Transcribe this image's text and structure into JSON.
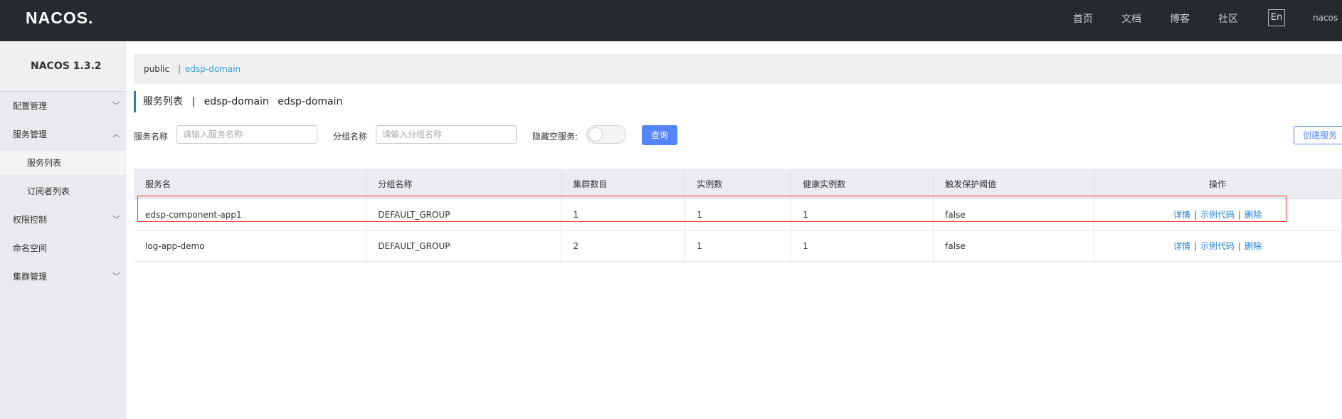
{
  "navbar": {
    "logo": "NACOS.",
    "links": [
      "首页",
      "文档",
      "博客",
      "社区"
    ],
    "lang": "En",
    "user": "nacos"
  },
  "sidebar": {
    "version": "NACOS 1.3.2",
    "items": [
      {
        "label": "配置管理",
        "expanded": false
      },
      {
        "label": "服务管理",
        "expanded": true
      },
      {
        "label": "服务列表",
        "sub": true,
        "active": true
      },
      {
        "label": "订阅者列表",
        "sub": true
      },
      {
        "label": "权限控制",
        "expanded": false
      },
      {
        "label": "命名空间"
      },
      {
        "label": "集群管理",
        "expanded": false
      }
    ]
  },
  "namespace": {
    "public": "public",
    "separator": "|",
    "current": "edsp-domain"
  },
  "title": {
    "main": "服务列表",
    "sep": "|",
    "ns1": "edsp-domain",
    "ns2": "edsp-domain"
  },
  "filters": {
    "service_label": "服务名称",
    "service_placeholder": "请输入服务名称",
    "group_label": "分组名称",
    "group_placeholder": "请输入分组名称",
    "hide_empty_label": "隐藏空服务:",
    "hide_empty_on": false,
    "query_label": "查询",
    "create_label": "创建服务"
  },
  "table": {
    "headers": [
      "服务名",
      "分组名称",
      "集群数目",
      "实例数",
      "健康实例数",
      "触发保护阈值",
      "操作"
    ],
    "rows": [
      {
        "name": "edsp-component-app1",
        "group": "DEFAULT_GROUP",
        "clusters": "1",
        "instances": "1",
        "healthy": "1",
        "threshold": "false"
      },
      {
        "name": "log-app-demo",
        "group": "DEFAULT_GROUP",
        "clusters": "2",
        "instances": "1",
        "healthy": "1",
        "threshold": "false"
      }
    ],
    "actions": {
      "detail": "详情",
      "sample": "示例代码",
      "delete": "删除",
      "sep": "|"
    }
  },
  "colors": {
    "navbar_bg": "#252a2f",
    "primary": "#5584ff",
    "link": "#1e7ed8",
    "highlight_border": "#e33"
  }
}
